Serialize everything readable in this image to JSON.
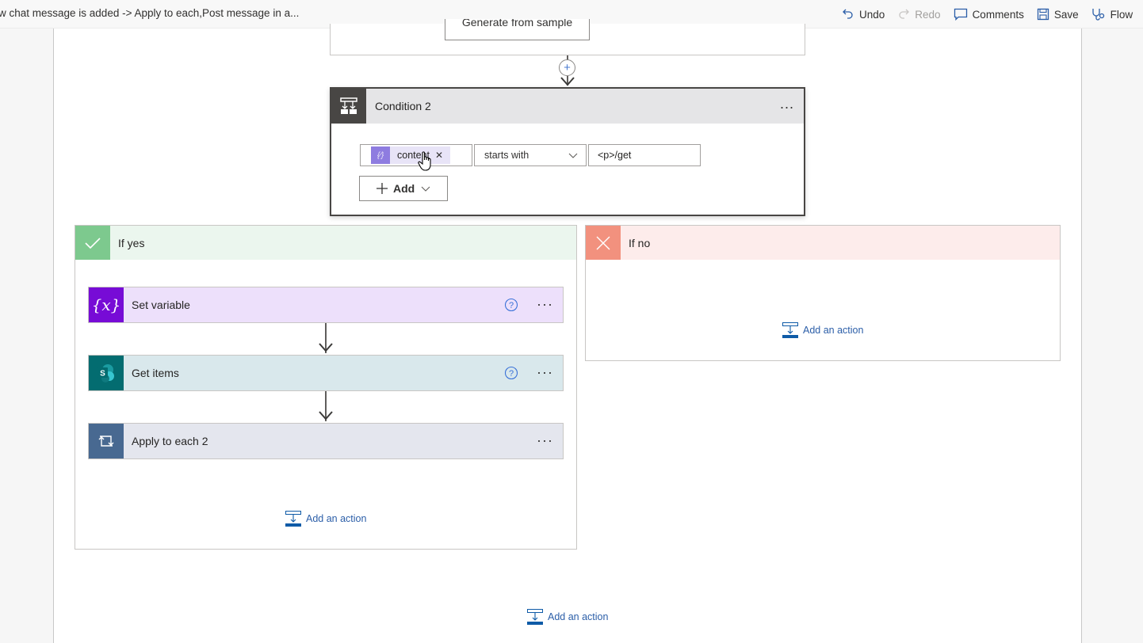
{
  "header": {
    "breadcrumb": "w chat message is added -> Apply to each,Post message in a...",
    "commands": [
      {
        "label": "Undo",
        "icon": "undo-icon",
        "enabled": true
      },
      {
        "label": "Redo",
        "icon": "redo-icon",
        "enabled": false
      },
      {
        "label": "Comments",
        "icon": "comment-icon",
        "enabled": true
      },
      {
        "label": "Save",
        "icon": "save-icon",
        "enabled": true
      },
      {
        "label": "Flow",
        "icon": "flow-checker-icon",
        "enabled": true
      }
    ]
  },
  "previous_step": {
    "generate_button_label": "Generate from sample"
  },
  "condition": {
    "title": "Condition 2",
    "icon": "condition-icon",
    "more_label": "...",
    "row": {
      "operand_token": "content",
      "operator": "starts with",
      "value": "<p>/get"
    },
    "add_button_label": "Add"
  },
  "branches": {
    "yes": {
      "title": "If yes",
      "actions": [
        {
          "title": "Set variable",
          "icon": "variable-icon",
          "has_help": true,
          "color": "#ede0fb",
          "icon_color": "#770bd6"
        },
        {
          "title": "Get items",
          "icon": "sharepoint-icon",
          "has_help": true,
          "color": "#d9e8ec",
          "icon_color": "#036c70"
        },
        {
          "title": "Apply to each 2",
          "icon": "loop-icon",
          "has_help": false,
          "color": "#e4e6ee",
          "icon_color": "#486991"
        }
      ],
      "add_action_label": "Add an action"
    },
    "no": {
      "title": "If no",
      "add_action_label": "Add an action"
    }
  },
  "footer": {
    "add_action_label": "Add an action"
  },
  "colors": {
    "accent": "#2b5ea8",
    "yes": "#7dc98e",
    "no": "#f2917e"
  }
}
